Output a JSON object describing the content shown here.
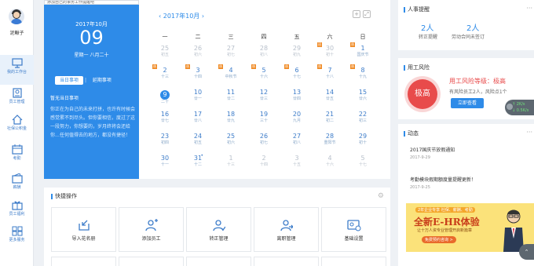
{
  "user": {
    "name": "泥鳅子"
  },
  "nav": [
    {
      "label": "我的工作台",
      "icon": "desktop-icon"
    },
    {
      "label": "员工管理",
      "icon": "employee-icon"
    },
    {
      "label": "社保公积金",
      "icon": "house-icon"
    },
    {
      "label": "考勤",
      "icon": "calendar-icon"
    },
    {
      "label": "薪酬",
      "icon": "wallet-icon"
    },
    {
      "label": "员工福利",
      "icon": "gift-icon"
    },
    {
      "label": "更多服务",
      "icon": "grid-icon"
    }
  ],
  "tooltip": "添加自己的事务工作提醒吧",
  "today": {
    "ym": "2017年10月",
    "day": "09",
    "weekday": "星期一  八月二十"
  },
  "events": {
    "tab_today": "当日事项",
    "tab_late": "延期事项",
    "empty": "暂无当日事项",
    "quote": "你正在为自己的未来打拼，也许有时候会感觉累不到尽头。但你要相信，度过了这一段努力，你想要的，岁月终将会还给你…任何值得去的地方，都没有捷径！"
  },
  "calendar": {
    "header": "‹  2017年10月  ›",
    "weekdays": [
      "一",
      "二",
      "三",
      "四",
      "五",
      "六",
      "日"
    ],
    "weeks": [
      [
        {
          "d": "25",
          "l": "初五",
          "o": 1
        },
        {
          "d": "26",
          "l": "初六",
          "o": 1
        },
        {
          "d": "27",
          "l": "初七",
          "o": 1
        },
        {
          "d": "28",
          "l": "初八",
          "o": 1
        },
        {
          "d": "29",
          "l": "初九",
          "o": 1
        },
        {
          "d": "30",
          "l": "初十",
          "o": 1,
          "tag": "班"
        },
        {
          "d": "1",
          "l": "国庆节",
          "tag": "休"
        }
      ],
      [
        {
          "d": "2",
          "l": "十三",
          "tag": "休"
        },
        {
          "d": "3",
          "l": "十四",
          "tag": "休"
        },
        {
          "d": "4",
          "l": "中秋节",
          "tag": "休"
        },
        {
          "d": "5",
          "l": "十六",
          "tag": "休"
        },
        {
          "d": "6",
          "l": "十七",
          "tag": "休"
        },
        {
          "d": "7",
          "l": "十八",
          "tag": "休"
        },
        {
          "d": "8",
          "l": "十九",
          "tag": "休"
        }
      ],
      [
        {
          "d": "9",
          "l": "二十",
          "today": 1
        },
        {
          "d": "10",
          "l": "廿一"
        },
        {
          "d": "11",
          "l": "廿二"
        },
        {
          "d": "12",
          "l": "廿三"
        },
        {
          "d": "13",
          "l": "廿四"
        },
        {
          "d": "14",
          "l": "廿五"
        },
        {
          "d": "15",
          "l": "廿六"
        }
      ],
      [
        {
          "d": "16",
          "l": "廿七"
        },
        {
          "d": "17",
          "l": "廿八"
        },
        {
          "d": "18",
          "l": "廿九"
        },
        {
          "d": "19",
          "l": "三十"
        },
        {
          "d": "20",
          "l": "九月"
        },
        {
          "d": "21",
          "l": "初二"
        },
        {
          "d": "22",
          "l": "初三"
        }
      ],
      [
        {
          "d": "23",
          "l": "初四"
        },
        {
          "d": "24",
          "l": "初五"
        },
        {
          "d": "25",
          "l": "初六"
        },
        {
          "d": "26",
          "l": "初七"
        },
        {
          "d": "27",
          "l": "初八"
        },
        {
          "d": "28",
          "l": "重阳节"
        },
        {
          "d": "29",
          "l": "初十"
        }
      ],
      [
        {
          "d": "30",
          "l": "十一"
        },
        {
          "d": "31",
          "l": "十二",
          "dot": 1
        },
        {
          "d": "1",
          "l": "十三",
          "o": 1
        },
        {
          "d": "2",
          "l": "十四",
          "o": 1
        },
        {
          "d": "3",
          "l": "十五",
          "o": 1
        },
        {
          "d": "4",
          "l": "十六",
          "o": 1
        },
        {
          "d": "5",
          "l": "十七",
          "o": 1
        }
      ]
    ]
  },
  "quick": {
    "title": "快捷操作",
    "items": [
      {
        "label": "导入花名册",
        "icon": "import-icon"
      },
      {
        "label": "添加员工",
        "icon": "add-user-icon"
      },
      {
        "label": "转正管理",
        "icon": "promote-icon"
      },
      {
        "label": "离职管理",
        "icon": "resign-icon"
      },
      {
        "label": "基础设置",
        "icon": "settings-card-icon"
      }
    ]
  },
  "hr": {
    "title": "人事提醒",
    "stats": [
      {
        "value": "2人",
        "label": "转正提醒"
      },
      {
        "value": "2人",
        "label": "劳动合同未签订"
      }
    ]
  },
  "risk": {
    "title": "用工风险",
    "badge": "极高",
    "level": "用工风险等级：极高",
    "desc": "有风险员工2人，风险点1个",
    "button": "立即查看"
  },
  "speed": {
    "up": "↑ 2K/s",
    "down": "↓ 0.5K/s"
  },
  "news": {
    "title": "动态",
    "items": [
      {
        "title": "2017国庆节放假通知",
        "date": "2017-9-29"
      },
      {
        "title": "考勤模块假期额度量提醒更新！",
        "date": "2017-9-25"
      }
    ]
  },
  "banner": {
    "tag": "2年企业专享 社保、薪酬、考勤",
    "headline": "全新E-HR体验",
    "sub": "让十万人资专业管理开启新篇章",
    "cta": "免费预约咨询 >"
  },
  "colors": {
    "primary": "#2e8be8",
    "risk": "#e84b4b",
    "holiday": "#f08c28"
  }
}
